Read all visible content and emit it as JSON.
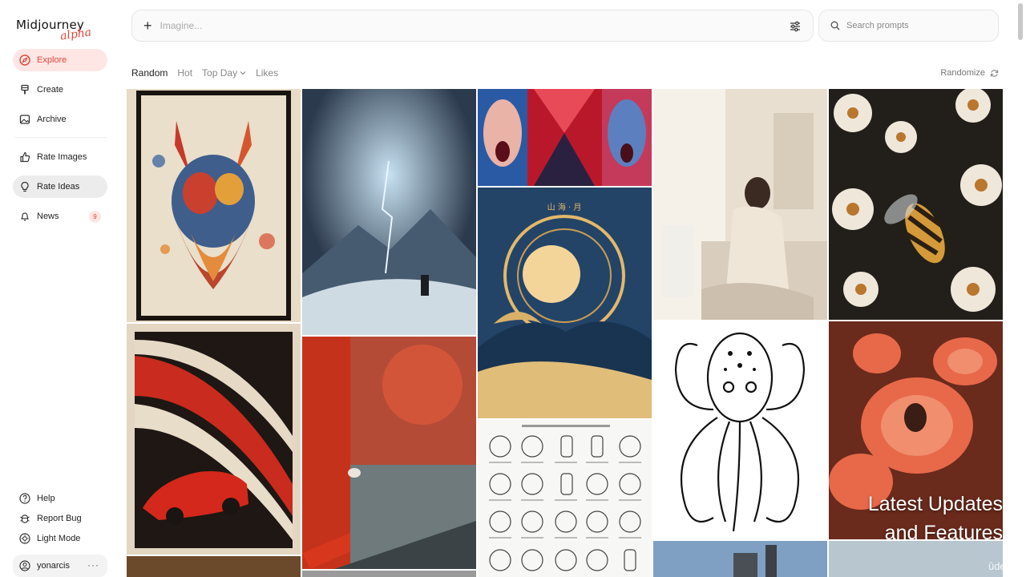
{
  "app": {
    "name": "Midjourney",
    "tag": "alpha"
  },
  "sidebar": {
    "items": [
      {
        "label": "Explore"
      },
      {
        "label": "Create"
      },
      {
        "label": "Archive"
      },
      {
        "label": "Rate Images"
      },
      {
        "label": "Rate Ideas"
      },
      {
        "label": "News",
        "badge": "9"
      }
    ],
    "bottom": [
      {
        "label": "Help"
      },
      {
        "label": "Report Bug"
      },
      {
        "label": "Light Mode"
      }
    ],
    "user": {
      "name": "yonarcis",
      "more": "···"
    }
  },
  "topbar": {
    "imagine_placeholder": "Imagine...",
    "search_placeholder": "Search prompts"
  },
  "filters": {
    "tabs": [
      "Random",
      "Hot",
      "Top Day",
      "Likes"
    ],
    "active": "Random",
    "randomize_label": "Randomize"
  },
  "overlay": {
    "line1": "Latest Updates",
    "line2": "and Features"
  },
  "watermark": "ûdemy",
  "colors": {
    "accent": "#e0463a",
    "accent_bg": "#fde6e4"
  }
}
